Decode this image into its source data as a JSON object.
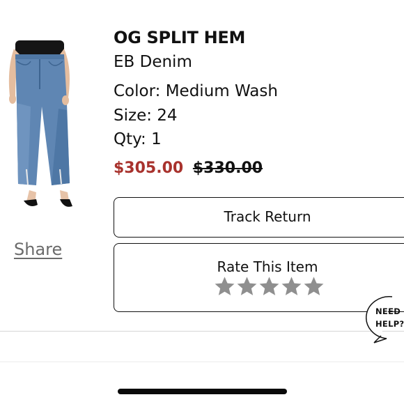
{
  "product": {
    "image_icon": "jeans-model-photo",
    "title": "OG SPLIT HEM",
    "brand": "EB Denim",
    "color_line": "Color: Medium Wash",
    "size_line": "Size: 24",
    "qty_line": "Qty: 1",
    "sale_price": "$305.00",
    "original_price": "$330.00",
    "sale_price_color": "#a8322d"
  },
  "actions": {
    "share_label": "Share",
    "track_return_label": "Track Return",
    "rate_item_label": "Rate This Item",
    "rating": {
      "value": 0,
      "max": 5,
      "star_color": "#8f8f8f"
    }
  },
  "help": {
    "line1": "NEED",
    "line2": "HELP?",
    "icon": "speech-bubble-icon"
  }
}
